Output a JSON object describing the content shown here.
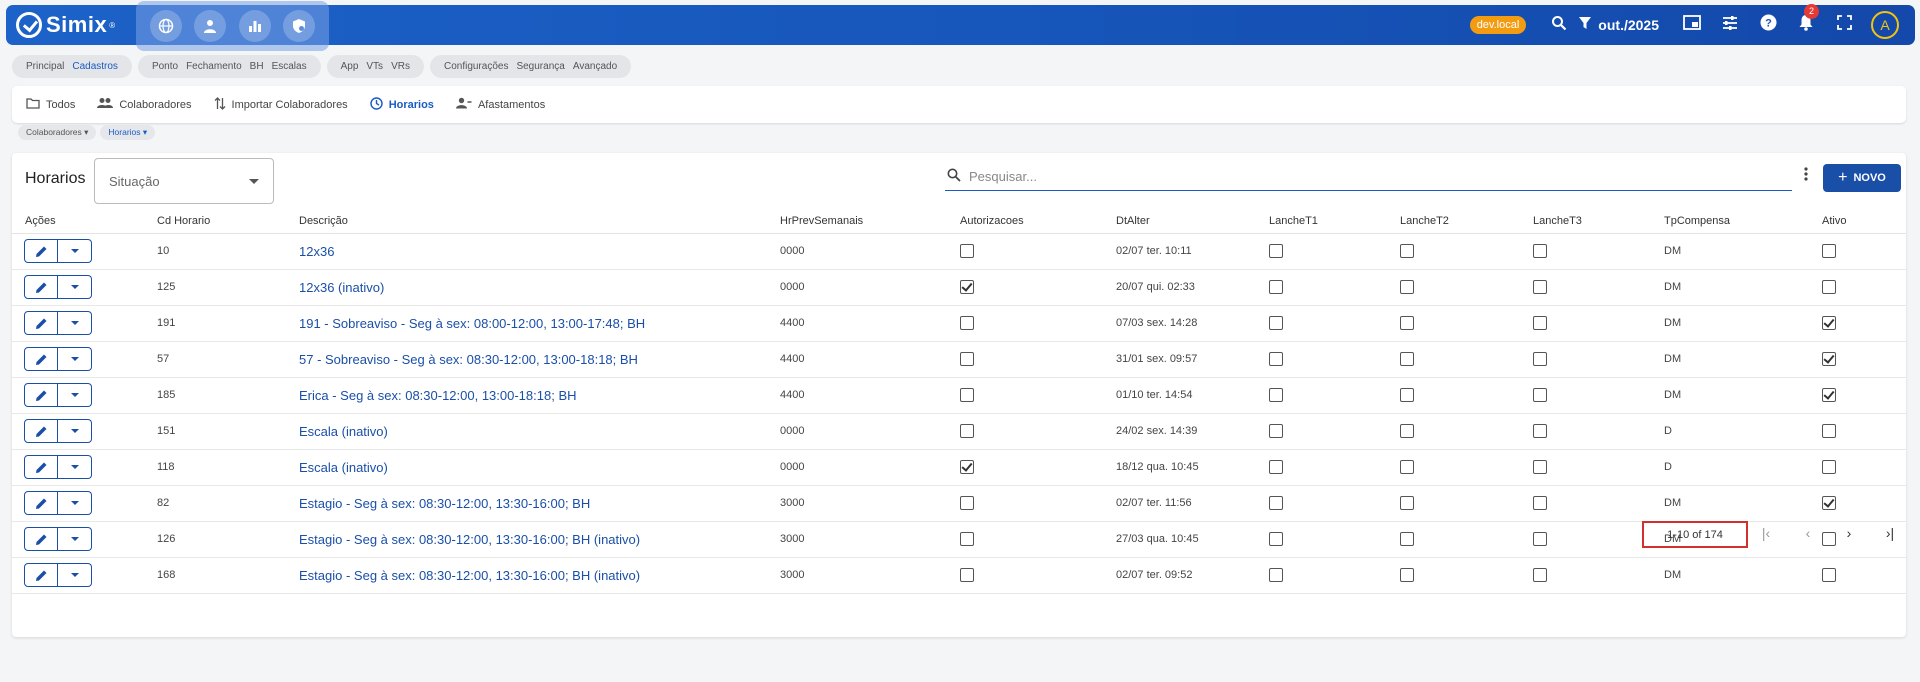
{
  "app": {
    "brand": "Simix",
    "brand_mark": "®",
    "env_badge": "dev.local",
    "period": "out./2025",
    "notification_count": "2",
    "avatar_initial": "A"
  },
  "modules": [
    {
      "items": [
        {
          "label": "Principal",
          "active": false
        },
        {
          "label": "Cadastros",
          "active": true
        }
      ]
    },
    {
      "items": [
        {
          "label": "Ponto",
          "active": false
        },
        {
          "label": "Fechamento",
          "active": false
        },
        {
          "label": "BH",
          "active": false
        },
        {
          "label": "Escalas",
          "active": false
        }
      ]
    },
    {
      "items": [
        {
          "label": "App",
          "active": false
        },
        {
          "label": "VTs",
          "active": false
        },
        {
          "label": "VRs",
          "active": false
        }
      ]
    },
    {
      "items": [
        {
          "label": "Configurações",
          "active": false
        },
        {
          "label": "Segurança",
          "active": false
        },
        {
          "label": "Avançado",
          "active": false
        }
      ]
    }
  ],
  "subnav": {
    "todos": "Todos",
    "colaboradores": "Colaboradores",
    "importar": "Importar Colaboradores",
    "horarios": "Horarios",
    "afastamentos": "Afastamentos"
  },
  "breadcrumb": {
    "first": "Colaboradores",
    "second": "Horarios"
  },
  "page": {
    "title": "Horarios",
    "situacao_placeholder": "Situação",
    "search_placeholder": "Pesquisar...",
    "novo_label": "NOVO"
  },
  "table": {
    "headers": {
      "acoes": "Ações",
      "cd": "Cd Horario",
      "descricao": "Descrição",
      "hrprev": "HrPrevSemanais",
      "autoriz": "Autorizacoes",
      "dtalter": "DtAlter",
      "l1": "LancheT1",
      "l2": "LancheT2",
      "l3": "LancheT3",
      "tp": "TpCompensa",
      "ativo": "Ativo"
    },
    "rows": [
      {
        "cd": "10",
        "desc": "12x36",
        "hr": "0000",
        "aut": false,
        "dt": "02/07 ter. 10:11",
        "l1": false,
        "l2": false,
        "l3": false,
        "tp": "DM",
        "ativo": false
      },
      {
        "cd": "125",
        "desc": "12x36 (inativo)",
        "hr": "0000",
        "aut": true,
        "dt": "20/07 qui. 02:33",
        "l1": false,
        "l2": false,
        "l3": false,
        "tp": "DM",
        "ativo": false
      },
      {
        "cd": "191",
        "desc": "191 - Sobreaviso - Seg à sex: 08:00-12:00, 13:00-17:48; BH",
        "hr": "4400",
        "aut": false,
        "dt": "07/03 sex. 14:28",
        "l1": false,
        "l2": false,
        "l3": false,
        "tp": "DM",
        "ativo": true
      },
      {
        "cd": "57",
        "desc": "57 - Sobreaviso - Seg à sex: 08:30-12:00, 13:00-18:18; BH",
        "hr": "4400",
        "aut": false,
        "dt": "31/01 sex. 09:57",
        "l1": false,
        "l2": false,
        "l3": false,
        "tp": "DM",
        "ativo": true
      },
      {
        "cd": "185",
        "desc": "Erica - Seg à sex: 08:30-12:00, 13:00-18:18; BH",
        "hr": "4400",
        "aut": false,
        "dt": "01/10 ter. 14:54",
        "l1": false,
        "l2": false,
        "l3": false,
        "tp": "DM",
        "ativo": true
      },
      {
        "cd": "151",
        "desc": "Escala (inativo)",
        "hr": "0000",
        "aut": false,
        "dt": "24/02 sex. 14:39",
        "l1": false,
        "l2": false,
        "l3": false,
        "tp": "D",
        "ativo": false
      },
      {
        "cd": "118",
        "desc": "Escala (inativo)",
        "hr": "0000",
        "aut": true,
        "dt": "18/12 qua. 10:45",
        "l1": false,
        "l2": false,
        "l3": false,
        "tp": "D",
        "ativo": false
      },
      {
        "cd": "82",
        "desc": "Estagio - Seg à sex: 08:30-12:00, 13:30-16:00; BH",
        "hr": "3000",
        "aut": false,
        "dt": "02/07 ter. 11:56",
        "l1": false,
        "l2": false,
        "l3": false,
        "tp": "DM",
        "ativo": true
      },
      {
        "cd": "126",
        "desc": "Estagio - Seg à sex: 08:30-12:00, 13:30-16:00; BH (inativo)",
        "hr": "3000",
        "aut": false,
        "dt": "27/03 qua. 10:45",
        "l1": false,
        "l2": false,
        "l3": false,
        "tp": "DM",
        "ativo": false
      },
      {
        "cd": "168",
        "desc": "Estagio - Seg à sex: 08:30-12:00, 13:30-16:00; BH (inativo)",
        "hr": "3000",
        "aut": false,
        "dt": "02/07 ter. 09:52",
        "l1": false,
        "l2": false,
        "l3": false,
        "tp": "DM",
        "ativo": false
      }
    ]
  },
  "pagination": {
    "label": "1-10 of 174"
  },
  "icons": {
    "top_quick": [
      "globe-icon",
      "person-icon",
      "bar-chart-icon",
      "shield-gear-icon"
    ],
    "top_right": [
      "search-icon",
      "filter-icon",
      "picture-in-picture-icon",
      "tune-icon",
      "help-icon",
      "bell-icon",
      "fullscreen-icon"
    ]
  },
  "colors": {
    "primary": "#1a4fa8",
    "topbar": "#1d62c8",
    "env_badge": "#f39c12",
    "notification": "#e53935",
    "highlight_border": "#d0312d"
  }
}
